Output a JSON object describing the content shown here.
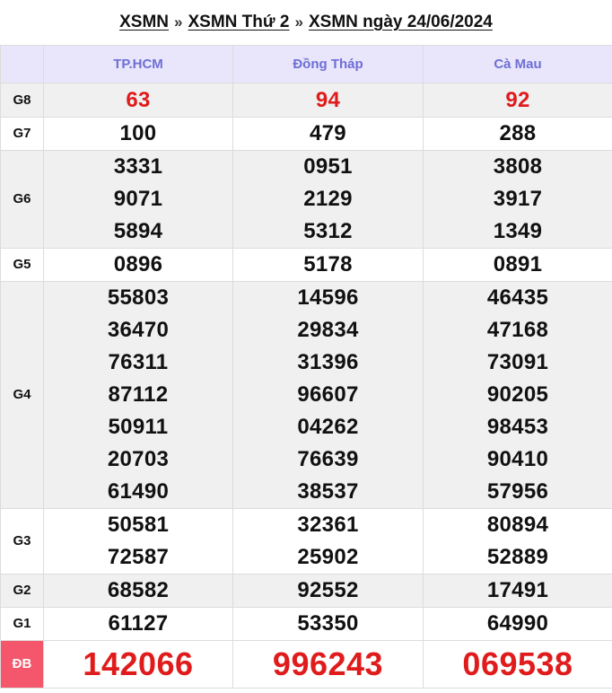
{
  "breadcrumb": {
    "items": [
      "XSMN",
      "XSMN Thứ 2",
      "XSMN ngày 24/06/2024"
    ],
    "separator": "»"
  },
  "provinces": [
    "TP.HCM",
    "Đồng Tháp",
    "Cà Mau"
  ],
  "prizes": [
    {
      "label": "G8",
      "style": "red",
      "shade": true,
      "values": [
        [
          "63"
        ],
        [
          "94"
        ],
        [
          "92"
        ]
      ]
    },
    {
      "label": "G7",
      "style": "normal",
      "shade": false,
      "values": [
        [
          "100"
        ],
        [
          "479"
        ],
        [
          "288"
        ]
      ]
    },
    {
      "label": "G6",
      "style": "normal",
      "shade": true,
      "values": [
        [
          "3331",
          "9071",
          "5894"
        ],
        [
          "0951",
          "2129",
          "5312"
        ],
        [
          "3808",
          "3917",
          "1349"
        ]
      ]
    },
    {
      "label": "G5",
      "style": "normal",
      "shade": false,
      "values": [
        [
          "0896"
        ],
        [
          "5178"
        ],
        [
          "0891"
        ]
      ]
    },
    {
      "label": "G4",
      "style": "normal",
      "shade": true,
      "values": [
        [
          "55803",
          "36470",
          "76311",
          "87112",
          "50911",
          "20703",
          "61490"
        ],
        [
          "14596",
          "29834",
          "31396",
          "96607",
          "04262",
          "76639",
          "38537"
        ],
        [
          "46435",
          "47168",
          "73091",
          "90205",
          "98453",
          "90410",
          "57956"
        ]
      ]
    },
    {
      "label": "G3",
      "style": "normal",
      "shade": false,
      "values": [
        [
          "50581",
          "72587"
        ],
        [
          "32361",
          "25902"
        ],
        [
          "80894",
          "52889"
        ]
      ]
    },
    {
      "label": "G2",
      "style": "normal",
      "shade": true,
      "values": [
        [
          "68582"
        ],
        [
          "92552"
        ],
        [
          "17491"
        ]
      ]
    },
    {
      "label": "G1",
      "style": "normal",
      "shade": false,
      "values": [
        [
          "61127"
        ],
        [
          "53350"
        ],
        [
          "64990"
        ]
      ]
    },
    {
      "label": "ĐB",
      "style": "jackpot",
      "shade": false,
      "values": [
        [
          "142066"
        ],
        [
          "996243"
        ],
        [
          "069538"
        ]
      ]
    }
  ],
  "colors": {
    "header_bg": "#e9e6fb",
    "header_text": "#6e6ed6",
    "red_number": "#e01b1b",
    "db_label_bg": "#f4566b",
    "shade_row": "#f0f0f0"
  }
}
